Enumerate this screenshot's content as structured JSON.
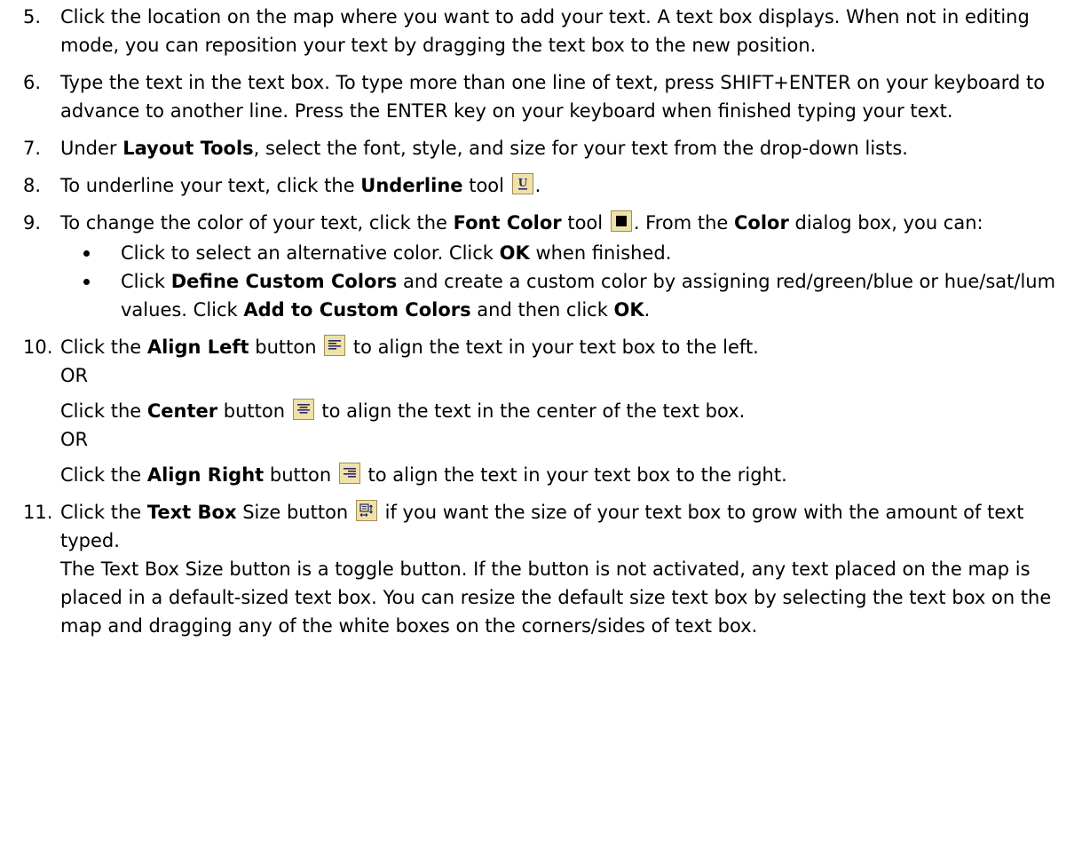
{
  "steps": {
    "s5": {
      "num": "5.",
      "text": "Click the location on the map where you want to add your text. A text box displays. When not in editing mode, you can reposition your text by dragging the text box to the new position."
    },
    "s6": {
      "num": "6.",
      "text": "Type the text in the text box. To type more than one line of text, press SHIFT+ENTER on your keyboard to advance to another line. Press the ENTER key on your keyboard when finished typing your text."
    },
    "s7": {
      "num": "7.",
      "pre": "Under ",
      "bold": "Layout Tools",
      "post": ", select the font, style, and size for your text from the drop-down lists."
    },
    "s8": {
      "num": "8.",
      "pre": "To underline your text, click the ",
      "bold": "Underline",
      "post": " tool",
      "end": "."
    },
    "s9": {
      "num": "9.",
      "pre": "To change the color of your text, click the ",
      "bold1": "Font Color",
      "mid1": " tool",
      "mid2": ". From the ",
      "bold2": "Color",
      "post": " dialog box, you can:",
      "bullets": {
        "b1": {
          "pre": "Click to select an alternative color. Click ",
          "bold": "OK",
          "post": " when finished."
        },
        "b2": {
          "pre": "Click ",
          "bold1": "Define Custom Colors",
          "mid": " and create a custom color by assigning red/green/blue or hue/sat/lum values. Click ",
          "bold2": "Add to Custom Colors",
          "mid2": " and then click ",
          "bold3": "OK",
          "end": "."
        }
      }
    },
    "s10": {
      "num": "10.",
      "a": {
        "pre": "Click the ",
        "bold": "Align Left",
        "mid": " button",
        "post": " to align the text in your text box to the left."
      },
      "or1": "OR",
      "b": {
        "pre": "Click the ",
        "bold": "Center",
        "mid": " button",
        "post": " to align the text in the center of the text box."
      },
      "or2": "OR",
      "c": {
        "pre": "Click the ",
        "bold": "Align Right",
        "mid": " button",
        "post": " to align the text in your text box to the right."
      }
    },
    "s11": {
      "num": "11.",
      "pre": "Click the ",
      "bold": "Text Box",
      "mid": " Size button",
      "post": " if you want the size of your text box to grow with the amount of text typed.",
      "para": "The Text Box Size button is a toggle button. If the button is not activated, any text placed on the map is placed in a default-sized text box. You can resize the default size text box by selecting the text box on the map and dragging any of the white boxes on the corners/sides of text box."
    }
  },
  "icons": {
    "underline": "underline-icon",
    "font_color": "font-color-icon",
    "align_left": "align-left-icon",
    "center": "align-center-icon",
    "align_right": "align-right-icon",
    "text_box_size": "text-box-size-icon"
  },
  "colors": {
    "icon_bg": "#efe1a8",
    "icon_border": "#a08c55",
    "icon_glyph": "#2a2a6a"
  }
}
